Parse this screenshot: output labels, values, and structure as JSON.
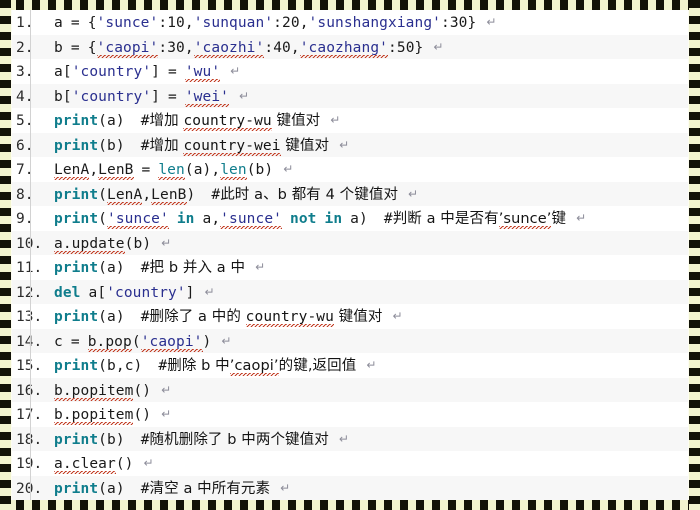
{
  "document": {
    "kind": "code-listing",
    "language": "Python",
    "topic": "dict-operations",
    "line_count": 20,
    "colors": {
      "page_background": "#ffffff",
      "frame_dash_dark": "#121208",
      "frame_dash_light": "#f2f4cf",
      "row_stripe": "#f7f7f7",
      "keyword": "#0f7d8c",
      "string": "#2a2f8f",
      "identifier": "#1a1a1a",
      "comment": "#141414",
      "spellcheck_squiggle": "#c23b22",
      "line_number": "#2b2b2b",
      "pilcrow": "#8d8d9a"
    },
    "pilcrow_glyph": "↵"
  },
  "lines": [
    {
      "n": "1.",
      "plain": "a = {'sunce':10,'sunquan':20,'sunshangxiang':30}",
      "pilcrow": "↵"
    },
    {
      "n": "2.",
      "plain": "b = {'caopi':30,'caozhi':40,'caozhang':50}",
      "pilcrow": "↵"
    },
    {
      "n": "3.",
      "plain": "a['country'] = 'wu'",
      "pilcrow": "↵"
    },
    {
      "n": "4.",
      "plain": "b['country'] = 'wei'",
      "pilcrow": "↵"
    },
    {
      "n": "5.",
      "plain": "print(a)   #增加 country-wu 键值对",
      "comment": "#增加 country-wu 键值对",
      "pilcrow": "↵"
    },
    {
      "n": "6.",
      "plain": "print(b)   #增加 country-wei 键值对",
      "comment": "#增加 country-wei 键值对",
      "pilcrow": "↵"
    },
    {
      "n": "7.",
      "plain": "LenA,LenB = len(a),len(b)",
      "pilcrow": "↵"
    },
    {
      "n": "8.",
      "plain": "print(LenA,LenB)   #此时 a、b 都有 4 个键值对",
      "comment": "#此时 a、b 都有 4 个键值对",
      "pilcrow": "↵"
    },
    {
      "n": "9.",
      "plain": "print('sunce' in a,'sunce' not in a)   #判断 a 中是否有’sunce’键",
      "comment": "#判断 a 中是否有’sunce’键",
      "pilcrow": "↵"
    },
    {
      "n": "10.",
      "plain": "a.update(b)",
      "pilcrow": "↵"
    },
    {
      "n": "11.",
      "plain": "print(a)   #把 b 并入 a 中",
      "comment": "#把 b 并入 a 中",
      "pilcrow": "↵"
    },
    {
      "n": "12.",
      "plain": "del a['country']",
      "pilcrow": "↵"
    },
    {
      "n": "13.",
      "plain": "print(a)   #删除了 a 中的 country-wu 键值对",
      "comment": "#删除了 a 中的 country-wu 键值对",
      "pilcrow": "↵"
    },
    {
      "n": "14.",
      "plain": "c = b.pop('caopi')",
      "pilcrow": "↵"
    },
    {
      "n": "15.",
      "plain": "print(b,c)   #删除 b 中’caopi’的键,返回值",
      "comment": "#删除 b 中’caopi’的键,返回值",
      "pilcrow": "↵"
    },
    {
      "n": "16.",
      "plain": "b.popitem()",
      "pilcrow": "↵"
    },
    {
      "n": "17.",
      "plain": "b.popitem()",
      "pilcrow": "↵"
    },
    {
      "n": "18.",
      "plain": "print(b)   #随机删除了 b 中两个键值对",
      "comment": "#随机删除了 b 中两个键值对",
      "pilcrow": "↵"
    },
    {
      "n": "19.",
      "plain": "a.clear()",
      "pilcrow": "↵"
    },
    {
      "n": "20.",
      "plain": "print(a)   #清空 a 中所有元素",
      "comment": "#清空 a 中所有元素",
      "pilcrow": "↵"
    }
  ],
  "tokens": {
    "keywords": [
      "print",
      "del",
      "in",
      "not",
      "len"
    ],
    "strings": [
      "'sunce'",
      "'sunquan'",
      "'sunshangxiang'",
      "'caopi'",
      "'caozhi'",
      "'caozhang'",
      "'country'",
      "'wu'",
      "'wei'"
    ],
    "numbers": [
      "10",
      "20",
      "30",
      "40",
      "50"
    ],
    "variables": [
      "a",
      "b",
      "c",
      "LenA",
      "LenB"
    ],
    "methods": [
      "update",
      "pop",
      "popitem",
      "clear"
    ]
  }
}
